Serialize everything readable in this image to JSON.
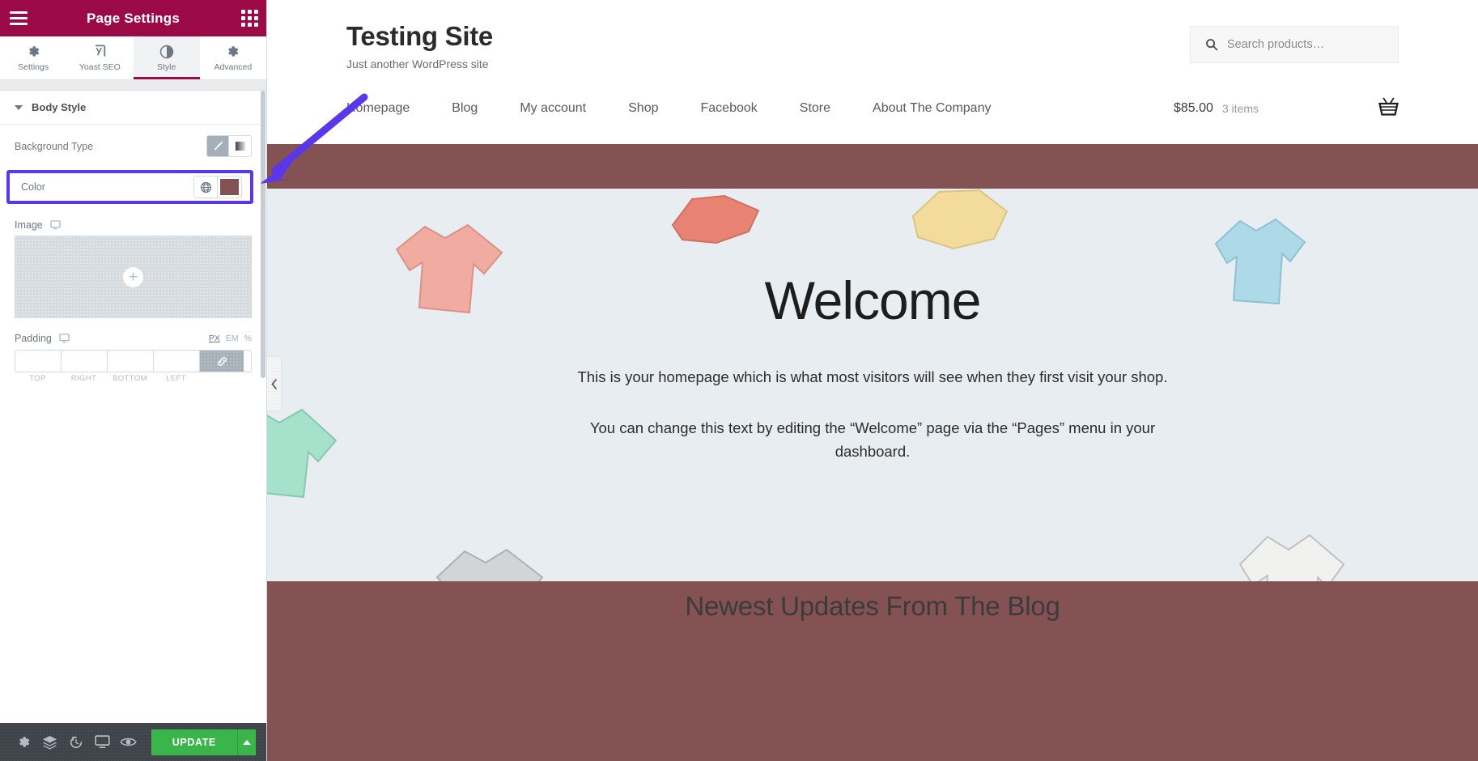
{
  "panel": {
    "title": "Page Settings",
    "menu_icon": "hamburger-icon",
    "grid_icon": "widgets-grid-icon",
    "tabs": [
      {
        "label": "Settings",
        "icon": "gear-icon",
        "active": false
      },
      {
        "label": "Yoast SEO",
        "icon": "yoast-logo-icon",
        "active": false
      },
      {
        "label": "Style",
        "icon": "contrast-circle-icon",
        "active": true
      },
      {
        "label": "Advanced",
        "icon": "gear-icon",
        "active": false
      }
    ],
    "section": {
      "title": "Body Style",
      "expanded": true
    },
    "controls": {
      "background_type": {
        "label": "Background Type",
        "options": [
          {
            "name": "classic",
            "icon": "paint-brush-icon",
            "active": true
          },
          {
            "name": "gradient",
            "icon": "gradient-bar-icon",
            "active": false
          }
        ]
      },
      "color": {
        "label": "Color",
        "globe_icon": "globe-icon",
        "value": "#845253",
        "highlighted": true,
        "highlight_color": "#5a37e8"
      },
      "image": {
        "label": "Image",
        "responsive_icon": "desktop-icon",
        "add_icon": "plus-icon"
      },
      "padding": {
        "label": "Padding",
        "responsive_icon": "desktop-icon",
        "units": [
          {
            "label": "PX",
            "active": true
          },
          {
            "label": "EM",
            "active": false
          },
          {
            "label": "%",
            "active": false
          }
        ],
        "fields": [
          {
            "sub": "TOP",
            "value": ""
          },
          {
            "sub": "RIGHT",
            "value": ""
          },
          {
            "sub": "BOTTOM",
            "value": ""
          },
          {
            "sub": "LEFT",
            "value": ""
          }
        ],
        "link_icon": "link-chain-icon"
      }
    },
    "footer": {
      "icons": [
        "settings-gear-icon",
        "navigator-layers-icon",
        "history-clock-icon",
        "responsive-mode-icon",
        "preview-eye-icon"
      ],
      "update_label": "UPDATE",
      "update_caret_icon": "caret-up-icon"
    }
  },
  "preview": {
    "site_title": "Testing Site",
    "tagline": "Just another WordPress site",
    "search": {
      "placeholder": "Search products…",
      "icon": "search-icon",
      "value": ""
    },
    "nav": [
      "Homepage",
      "Blog",
      "My account",
      "Shop",
      "Facebook",
      "Store",
      "About The Company"
    ],
    "cart": {
      "total": "$85.00",
      "items": "3 items",
      "icon": "shopping-basket-icon"
    },
    "hero": {
      "heading": "Welcome",
      "paragraph1": "This is your homepage which is what most visitors will see when they first visit your shop.",
      "paragraph2": "You can change this text by editing the “Welcome” page via the “Pages” menu in your dashboard."
    },
    "blog_section_title": "Newest Updates From The Blog",
    "collapse_icon": "chevron-left-icon",
    "colors": {
      "body_background": "#845253",
      "hero_background": "#e8edf1",
      "panel_header": "#9b0a46",
      "update_green": "#39b54a"
    }
  },
  "annotation": {
    "arrow_color": "#5a37e8",
    "arrow_icon": "pointer-arrow-icon",
    "target": "color-control-row"
  }
}
